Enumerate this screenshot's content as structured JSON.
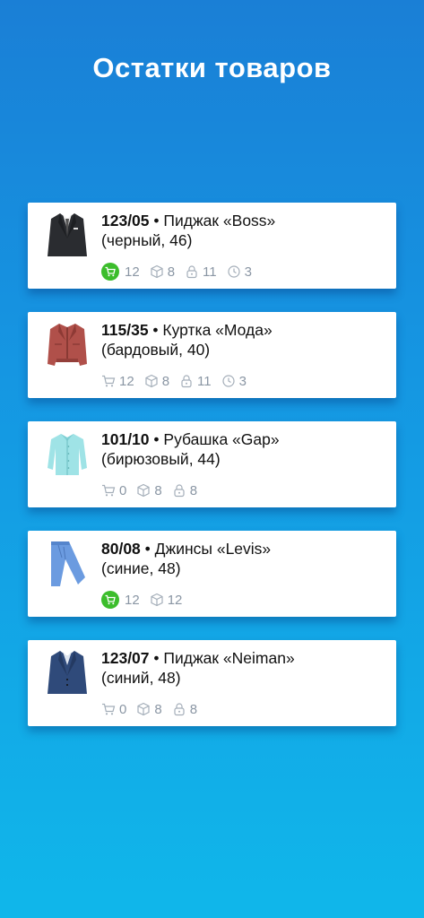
{
  "header": {
    "title": "Остатки товаров"
  },
  "colors": {
    "accent_green": "#3cbd2c",
    "stat_gray": "#8a96a4"
  },
  "products": [
    {
      "code": "123/05",
      "name": "Пиджак «Boss»",
      "detail": "(черный, 46)",
      "image": "dark-blazer-icon",
      "cart": "12",
      "cart_active": true,
      "box": "8",
      "lock": "11",
      "clock": "3"
    },
    {
      "code": "115/35",
      "name": "Куртка «Мода»",
      "detail": "(бардовый, 40)",
      "image": "leather-jacket-icon",
      "cart": "12",
      "cart_active": false,
      "box": "8",
      "lock": "11",
      "clock": "3"
    },
    {
      "code": "101/10",
      "name": "Рубашка  «Gap»",
      "detail": "(бирюзовый, 44)",
      "image": "shirt-icon",
      "cart": "0",
      "cart_active": false,
      "box": "8",
      "lock": "8"
    },
    {
      "code": "80/08",
      "name": "Джинсы  «Levis»",
      "detail": "(синие, 48)",
      "image": "jeans-icon",
      "cart": "12",
      "cart_active": true,
      "box": "12"
    },
    {
      "code": "123/07",
      "name": "Пиджак «Neiman»",
      "detail": "(синий, 48)",
      "image": "blue-blazer-icon",
      "cart": "0",
      "cart_active": false,
      "box": "8",
      "lock": "8"
    }
  ]
}
